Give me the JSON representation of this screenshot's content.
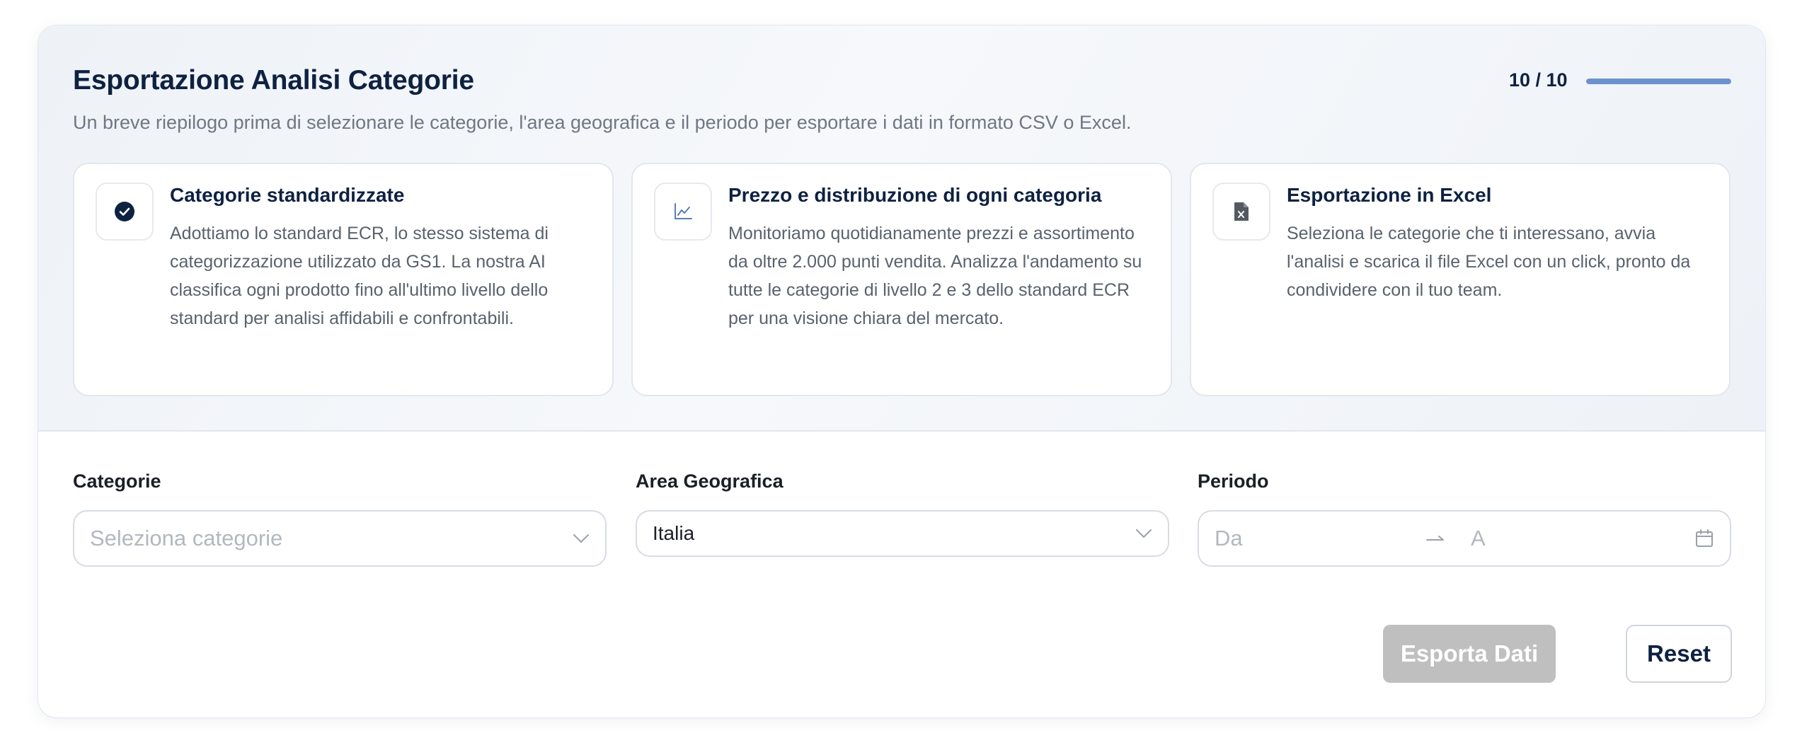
{
  "header": {
    "title": "Esportazione Analisi Categorie",
    "subtitle": "Un breve riepilogo prima di selezionare le categorie, l'area geografica e il periodo per esportare i dati in formato CSV o Excel.",
    "progress_text": "10 / 10",
    "progress_fraction": 1.0
  },
  "features": [
    {
      "icon": "check-circle-icon",
      "title": "Categorie standardizzate",
      "text": "Adottiamo lo standard ECR, lo stesso sistema di categorizzazione utilizzato da GS1. La nostra AI classifica ogni prodotto fino all'ultimo livello dello standard per analisi affidabili e confrontabili."
    },
    {
      "icon": "line-chart-icon",
      "title": "Prezzo e distribuzione di ogni categoria",
      "text": "Monitoriamo quotidianamente prezzi e assortimento da oltre 2.000 punti vendita. Analizza l'andamento su tutte le categorie di livello 2 e 3 dello standard ECR per una visione chiara del mercato."
    },
    {
      "icon": "excel-file-icon",
      "title": "Esportazione in Excel",
      "text": "Seleziona le categorie che ti interessano, avvia l'analisi e scarica il file Excel con un click, pronto da condividere con il tuo team."
    }
  ],
  "form": {
    "categories": {
      "label": "Categorie",
      "placeholder": "Seleziona categorie"
    },
    "area": {
      "label": "Area Geografica",
      "value": "Italia"
    },
    "period": {
      "label": "Periodo",
      "from_placeholder": "Da",
      "to_placeholder": "A"
    }
  },
  "actions": {
    "export_label": "Esporta Dati",
    "reset_label": "Reset"
  },
  "colors": {
    "primary": "#0e2141",
    "progress": "#6a92cc",
    "disabled": "#bfbfbf"
  }
}
